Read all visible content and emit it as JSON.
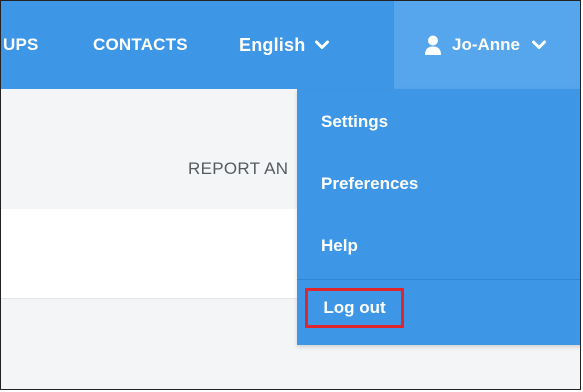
{
  "nav": {
    "groups_partial": "UPS",
    "contacts": "CONTACTS",
    "language": "English",
    "user": "Jo-Anne"
  },
  "main": {
    "report_partial": "REPORT AN"
  },
  "user_menu": {
    "items": [
      {
        "label": "Settings"
      },
      {
        "label": "Preferences"
      },
      {
        "label": "Help"
      },
      {
        "label": "Log out"
      }
    ],
    "highlight_color": "#e0252b"
  },
  "colors": {
    "topbar": "#3d97e6",
    "user_area": "#55a6ec",
    "text_light": "#ffffff",
    "page_band": "#f4f5f6"
  }
}
